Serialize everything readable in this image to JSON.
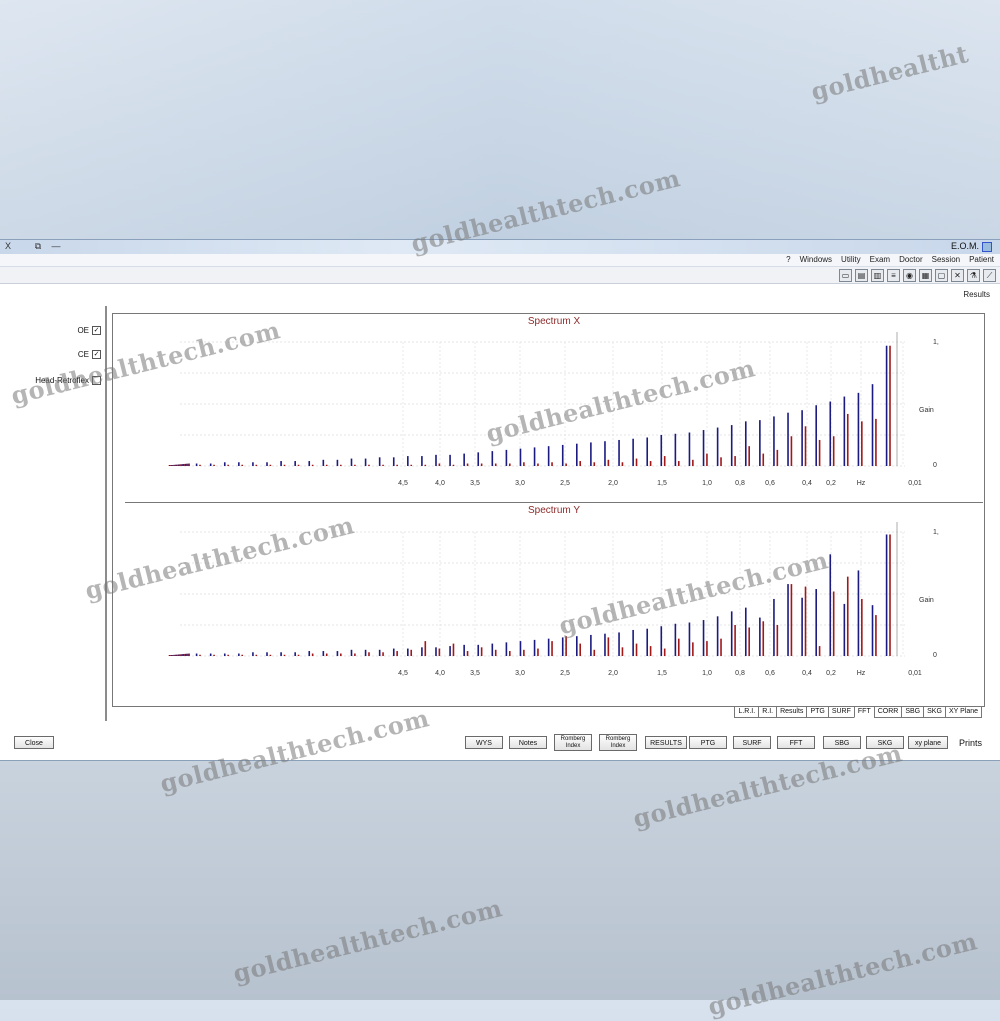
{
  "window": {
    "app_name": "E.O.M.",
    "menu": [
      "Patient",
      "Session",
      "Doctor",
      "Exam",
      "Utility",
      "Windows",
      "?"
    ],
    "controls": {
      "close": "X",
      "restore": "⧉",
      "minimize": "—"
    },
    "toolbar_icons": [
      "folder-icon",
      "save-icon",
      "print-icon",
      "list-icon",
      "eye-icon",
      "chart-icon",
      "notes-icon",
      "settings-icon",
      "flask-icon",
      "graph-icon"
    ],
    "section_label": "Results"
  },
  "options": {
    "oe_1": "OE",
    "oe_2": "CE",
    "head_retroflex": "Head-Retroflex"
  },
  "chart_data": [
    {
      "type": "bar",
      "title": "Spectrum X",
      "ylabel": "Gain",
      "xlabel": "Hz",
      "x_tick_labels": [
        "0,01",
        "Hz",
        "0,2",
        "0,4",
        "0,6",
        "0,8",
        "1,0",
        "1,5",
        "2,0",
        "2,5",
        "3,0",
        "3,5",
        "4,0",
        "4,5"
      ],
      "y_tick_labels": [
        "1,",
        "0"
      ],
      "ylim": [
        0,
        1
      ],
      "colors": {
        "blue": "#1a1a80",
        "red": "#a01818"
      },
      "series": [
        {
          "name": "blue",
          "values": [
            0.97,
            0.66,
            0.59,
            0.56,
            0.52,
            0.49,
            0.45,
            0.43,
            0.4,
            0.37,
            0.36,
            0.33,
            0.31,
            0.29,
            0.27,
            0.26,
            0.25,
            0.23,
            0.22,
            0.21,
            0.2,
            0.19,
            0.18,
            0.17,
            0.16,
            0.15,
            0.14,
            0.13,
            0.12,
            0.11,
            0.1,
            0.09,
            0.09,
            0.08,
            0.08,
            0.07,
            0.07,
            0.06,
            0.06,
            0.05,
            0.05,
            0.04,
            0.04,
            0.04,
            0.03,
            0.03,
            0.03,
            0.03,
            0.02,
            0.02
          ]
        },
        {
          "name": "red",
          "values": [
            0.97,
            0.38,
            0.36,
            0.42,
            0.24,
            0.21,
            0.32,
            0.24,
            0.13,
            0.1,
            0.16,
            0.08,
            0.07,
            0.1,
            0.05,
            0.04,
            0.08,
            0.04,
            0.06,
            0.03,
            0.05,
            0.03,
            0.04,
            0.02,
            0.03,
            0.02,
            0.03,
            0.02,
            0.02,
            0.02,
            0.02,
            0.01,
            0.02,
            0.01,
            0.01,
            0.01,
            0.01,
            0.01,
            0.01,
            0.01,
            0.01,
            0.01,
            0.01,
            0.01,
            0.01,
            0.01,
            0.01,
            0.01,
            0.01,
            0.01
          ]
        }
      ]
    },
    {
      "type": "bar",
      "title": "Spectrum Y",
      "ylabel": "Gain",
      "xlabel": "Hz",
      "x_tick_labels": [
        "0,01",
        "Hz",
        "0,2",
        "0,4",
        "0,6",
        "0,8",
        "1,0",
        "1,5",
        "2,0",
        "2,5",
        "3,0",
        "3,5",
        "4,0",
        "4,5"
      ],
      "y_tick_labels": [
        "1,",
        "0"
      ],
      "ylim": [
        0,
        1
      ],
      "colors": {
        "blue": "#1a1a80",
        "red": "#a01818"
      },
      "series": [
        {
          "name": "blue",
          "values": [
            0.98,
            0.41,
            0.69,
            0.42,
            0.82,
            0.54,
            0.47,
            0.58,
            0.46,
            0.31,
            0.39,
            0.36,
            0.32,
            0.29,
            0.27,
            0.26,
            0.24,
            0.22,
            0.21,
            0.19,
            0.18,
            0.17,
            0.16,
            0.15,
            0.14,
            0.13,
            0.12,
            0.11,
            0.1,
            0.09,
            0.09,
            0.08,
            0.07,
            0.07,
            0.06,
            0.06,
            0.05,
            0.05,
            0.05,
            0.04,
            0.04,
            0.04,
            0.03,
            0.03,
            0.03,
            0.03,
            0.02,
            0.02,
            0.02,
            0.02
          ]
        },
        {
          "name": "red",
          "values": [
            0.98,
            0.33,
            0.46,
            0.64,
            0.52,
            0.08,
            0.56,
            0.58,
            0.25,
            0.28,
            0.23,
            0.25,
            0.14,
            0.12,
            0.11,
            0.14,
            0.06,
            0.08,
            0.1,
            0.07,
            0.15,
            0.05,
            0.1,
            0.16,
            0.12,
            0.06,
            0.05,
            0.04,
            0.05,
            0.07,
            0.04,
            0.1,
            0.06,
            0.12,
            0.05,
            0.04,
            0.03,
            0.03,
            0.02,
            0.02,
            0.02,
            0.02,
            0.01,
            0.01,
            0.01,
            0.01,
            0.01,
            0.01,
            0.01,
            0.01
          ]
        }
      ]
    }
  ],
  "tabs": [
    "XY Plane",
    "SKG",
    "SBG",
    "CORR",
    "FFT",
    "SURF",
    "PTG",
    "Results",
    "R.I.",
    "L.R.I."
  ],
  "active_tab": "FFT",
  "bottom": {
    "prints_label": "Prints",
    "buttons": [
      "xy plane",
      "SKG",
      "SBG",
      "FFT",
      "SURF",
      "PTG",
      "RESULTS",
      "Romberg Index",
      "Romberg Index",
      "Notes",
      "WYS"
    ],
    "close_label": "Close"
  },
  "watermark": "goldhealthtech.com",
  "watermark_short": "goldhealtht"
}
